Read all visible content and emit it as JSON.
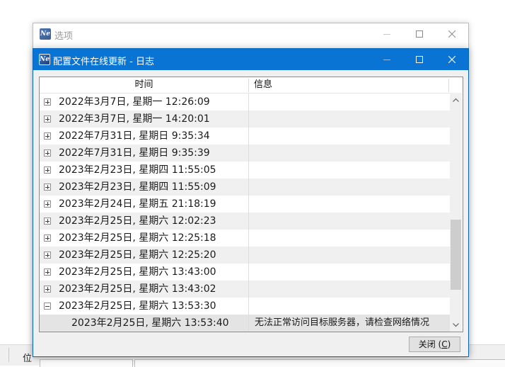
{
  "background": {
    "status_label": "位"
  },
  "back_window": {
    "title": "选项",
    "icon": "ne-app-icon"
  },
  "front_window": {
    "title": "配置文件在线更新 - 日志",
    "icon": "ne-app-icon",
    "accent": "#0a74d4"
  },
  "log_table": {
    "columns": [
      "时间",
      "信息"
    ],
    "rows": [
      {
        "time": "2022年3月7日, 星期一 12:26:09",
        "message": "",
        "expanded": false
      },
      {
        "time": "2022年3月7日, 星期一 14:20:01",
        "message": "",
        "expanded": false
      },
      {
        "time": "2022年7月31日, 星期日 9:35:34",
        "message": "",
        "expanded": false
      },
      {
        "time": "2022年7月31日, 星期日 9:35:39",
        "message": "",
        "expanded": false
      },
      {
        "time": "2023年2月23日, 星期四 11:55:05",
        "message": "",
        "expanded": false
      },
      {
        "time": "2023年2月23日, 星期四 11:55:09",
        "message": "",
        "expanded": false
      },
      {
        "time": "2023年2月24日, 星期五 21:18:19",
        "message": "",
        "expanded": false
      },
      {
        "time": "2023年2月25日, 星期六 12:02:23",
        "message": "",
        "expanded": false
      },
      {
        "time": "2023年2月25日, 星期六 12:25:18",
        "message": "",
        "expanded": false
      },
      {
        "time": "2023年2月25日, 星期六 12:25:20",
        "message": "",
        "expanded": false
      },
      {
        "time": "2023年2月25日, 星期六 13:43:00",
        "message": "",
        "expanded": false
      },
      {
        "time": "2023年2月25日, 星期六 13:43:02",
        "message": "",
        "expanded": false
      },
      {
        "time": "2023年2月25日, 星期六 13:53:30",
        "message": "",
        "expanded": true
      }
    ],
    "child_row": {
      "time": "2023年2月25日, 星期六 13:53:40",
      "message": "无法正常访问目标服务器，请检查网络情况"
    },
    "scroll_position": 0.78
  },
  "buttons": {
    "close_label": "关闭 (",
    "close_mnemonic": "C",
    "close_suffix": ")"
  }
}
